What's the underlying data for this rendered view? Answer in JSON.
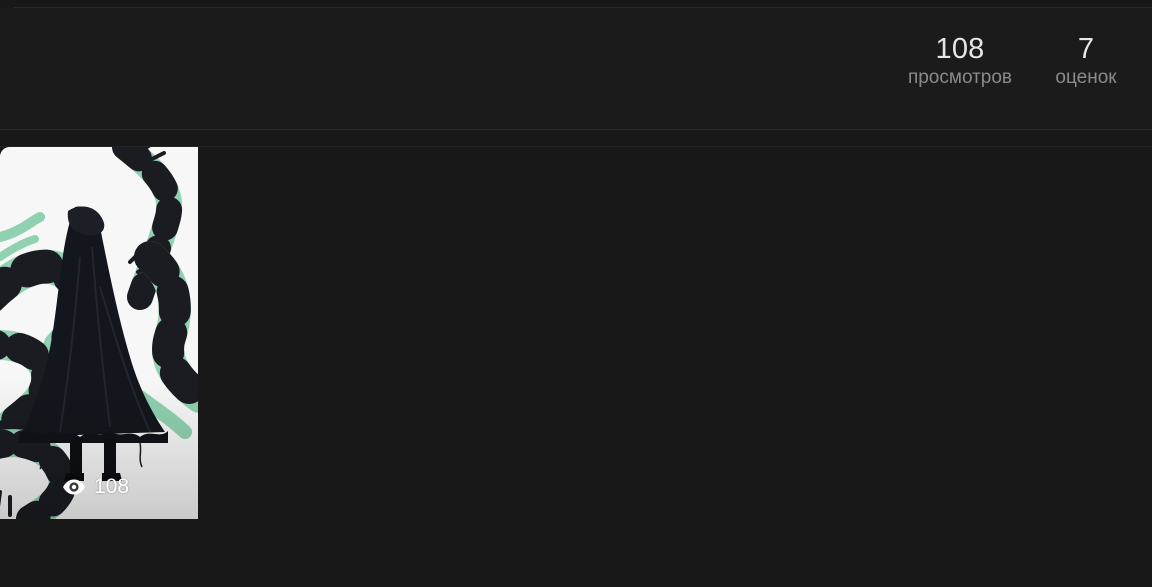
{
  "stats": {
    "views_value": "108",
    "views_label": "просмотров",
    "ratings_value": "7",
    "ratings_label": "оценок"
  },
  "gallery": {
    "items": [
      {
        "image": "dark-hooded-figure-with-green-frogs",
        "views_icon": "eye-icon",
        "views_count": "108"
      }
    ]
  },
  "colors": {
    "background": "#181818",
    "card": "#1b1b1b",
    "value_text": "#e6e6e6",
    "label_text": "#8a8a8a",
    "frog_green": "#8fd1b0",
    "frog_dark": "#1a1c22"
  }
}
